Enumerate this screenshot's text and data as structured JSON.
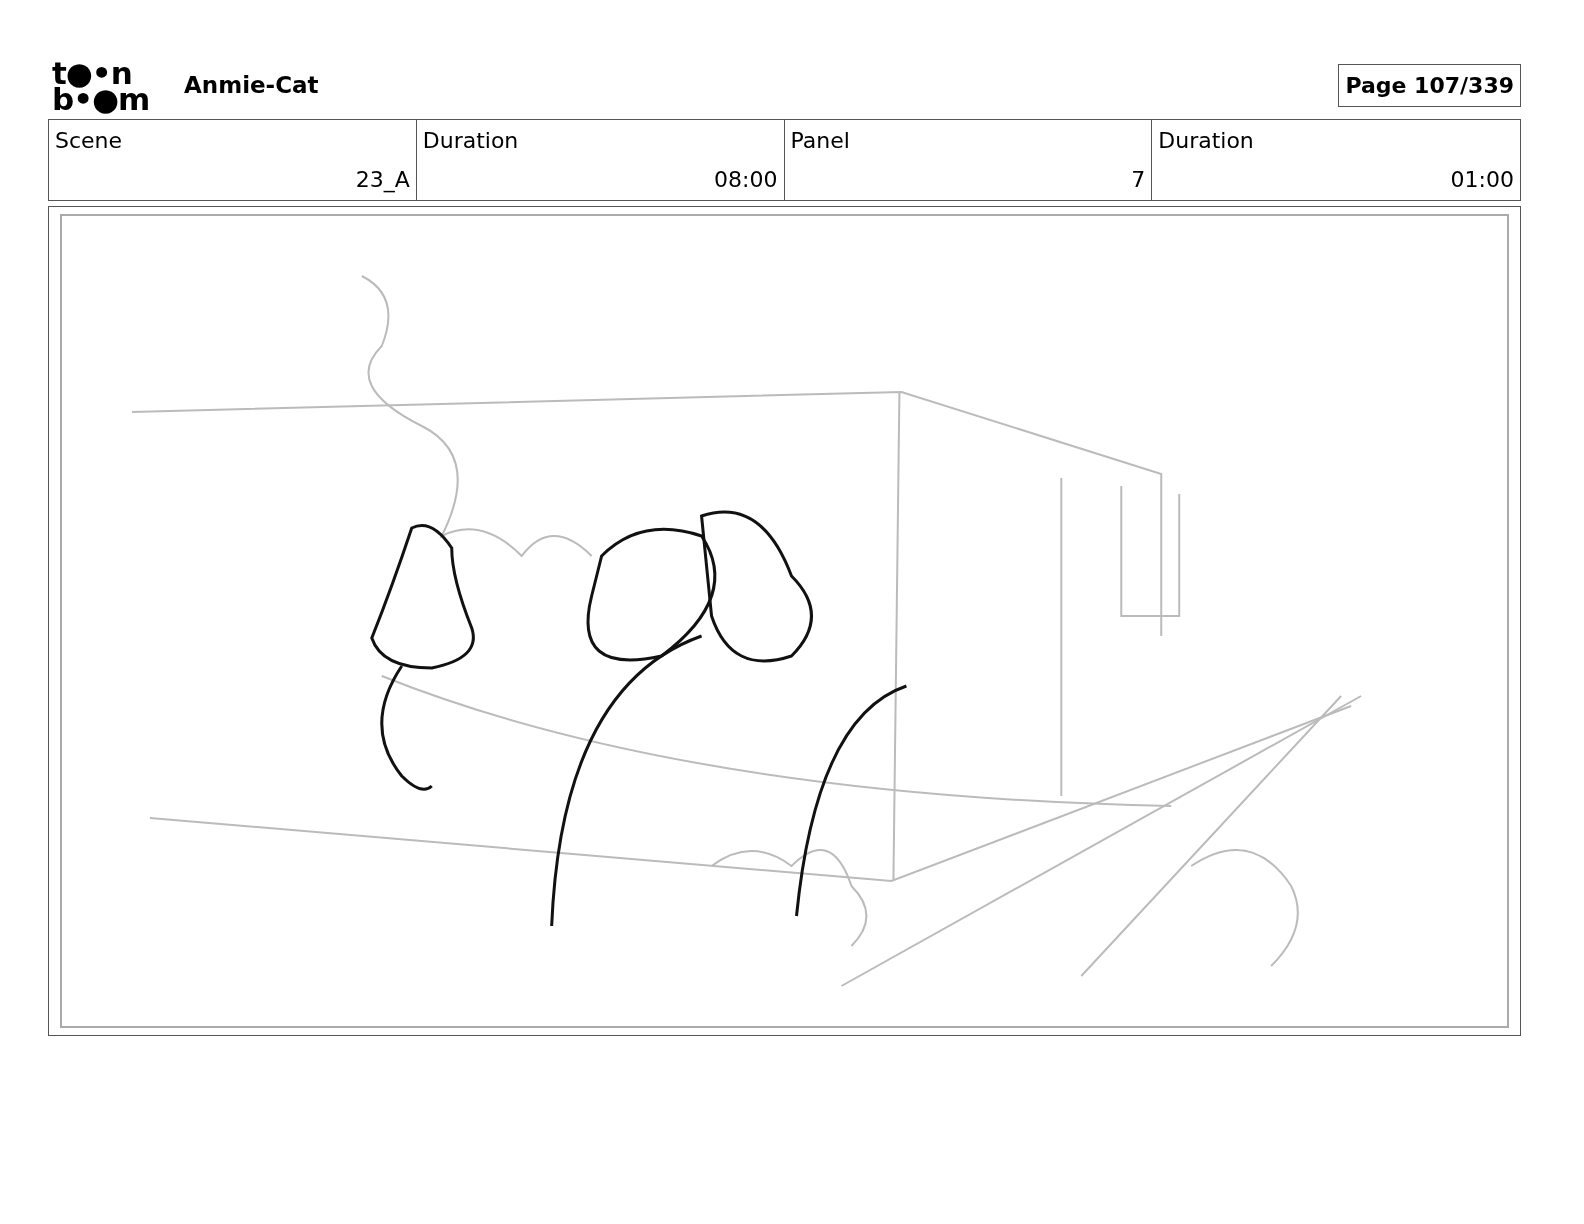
{
  "header": {
    "logo": [
      "t●•n",
      "b•●m"
    ],
    "title": "Anmie-Cat",
    "page": "Page 107/339"
  },
  "table": {
    "columns": [
      "Scene",
      "Duration",
      "Panel",
      "Duration"
    ],
    "rows": [
      [
        "23_A",
        "08:00",
        "7",
        "01:00"
      ]
    ]
  }
}
